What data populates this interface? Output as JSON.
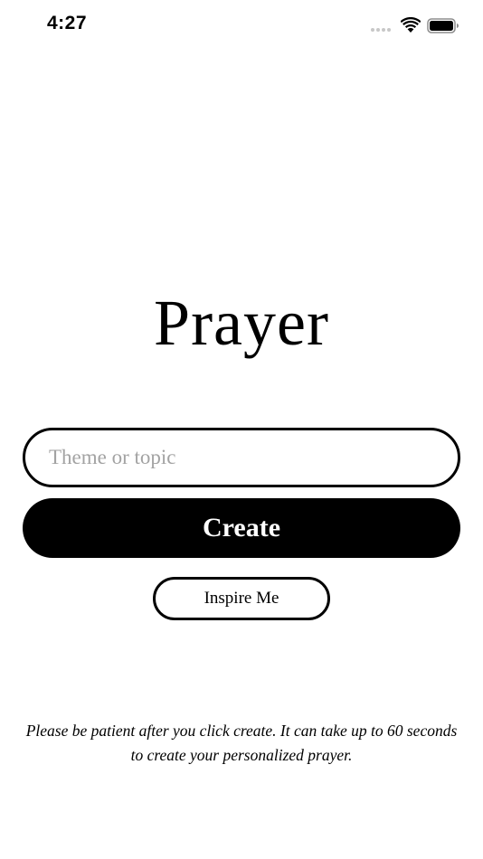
{
  "status_bar": {
    "time": "4:27",
    "icons": [
      "signal-dots-icon",
      "wifi-icon",
      "battery-icon"
    ]
  },
  "app": {
    "title": "Prayer"
  },
  "form": {
    "topic_placeholder": "Theme or topic",
    "topic_value": "",
    "create_label": "Create",
    "inspire_label": "Inspire Me"
  },
  "notice": {
    "text": "Please be patient after you click create. It can take up to 60 seconds to create your personalized prayer."
  },
  "colors": {
    "background": "#ffffff",
    "primary": "#000000",
    "placeholder": "#a3a3a3"
  }
}
